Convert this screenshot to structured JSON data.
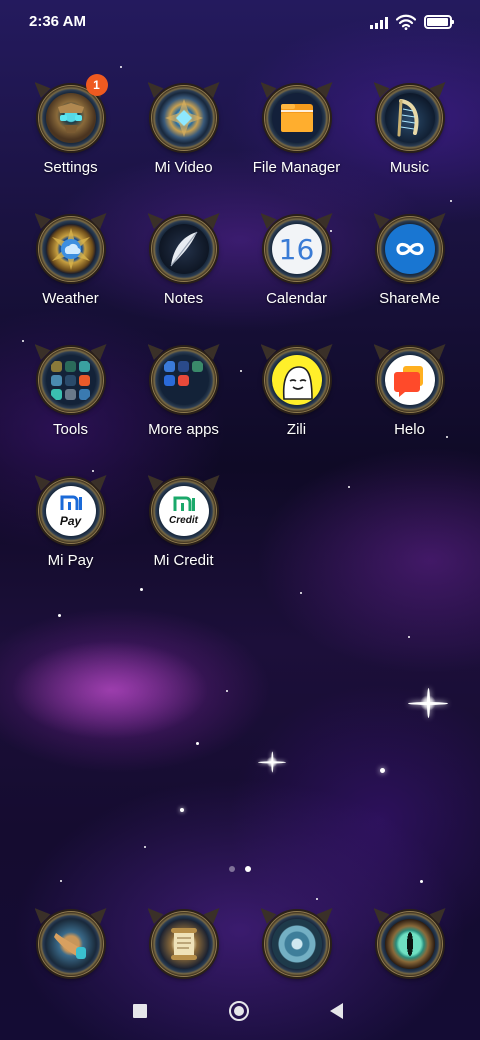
{
  "status_bar": {
    "time": "2:36 AM",
    "signal_icon": "signal-icon",
    "wifi_icon": "wifi-icon",
    "battery_icon": "battery-icon",
    "battery_level": 0.95
  },
  "apps": [
    {
      "label": "Settings",
      "icon": "settings-icon",
      "badge": "1"
    },
    {
      "label": "Mi Video",
      "icon": "mi-video-icon"
    },
    {
      "label": "File Manager",
      "icon": "file-manager-icon"
    },
    {
      "label": "Music",
      "icon": "music-icon"
    },
    {
      "label": "Weather",
      "icon": "weather-icon"
    },
    {
      "label": "Notes",
      "icon": "notes-icon"
    },
    {
      "label": "Calendar",
      "icon": "calendar-icon",
      "icon_text": "16"
    },
    {
      "label": "ShareMe",
      "icon": "shareme-icon"
    },
    {
      "label": "Tools",
      "icon": "tools-folder-icon"
    },
    {
      "label": "More apps",
      "icon": "more-apps-folder-icon"
    },
    {
      "label": "Zili",
      "icon": "zili-icon"
    },
    {
      "label": "Helo",
      "icon": "helo-icon"
    },
    {
      "label": "Mi Pay",
      "icon": "mi-pay-icon",
      "icon_text": "Pay"
    },
    {
      "label": "Mi Credit",
      "icon": "mi-credit-icon",
      "icon_text": "Credit"
    }
  ],
  "page_indicator": {
    "count": 2,
    "active": 1
  },
  "dock": [
    {
      "icon": "horn-icon"
    },
    {
      "icon": "scroll-icon"
    },
    {
      "icon": "browser-icon"
    },
    {
      "icon": "eye-icon"
    }
  ],
  "nav_bar": {
    "recent_icon": "recent-apps-icon",
    "home_icon": "home-icon",
    "back_icon": "back-icon"
  },
  "colors": {
    "badge": "#ef5a20",
    "calendar_accent": "#3a7bd5",
    "shareme": "#1976d2",
    "zili": "#ffef2a",
    "helo": "#ff4a2a"
  }
}
